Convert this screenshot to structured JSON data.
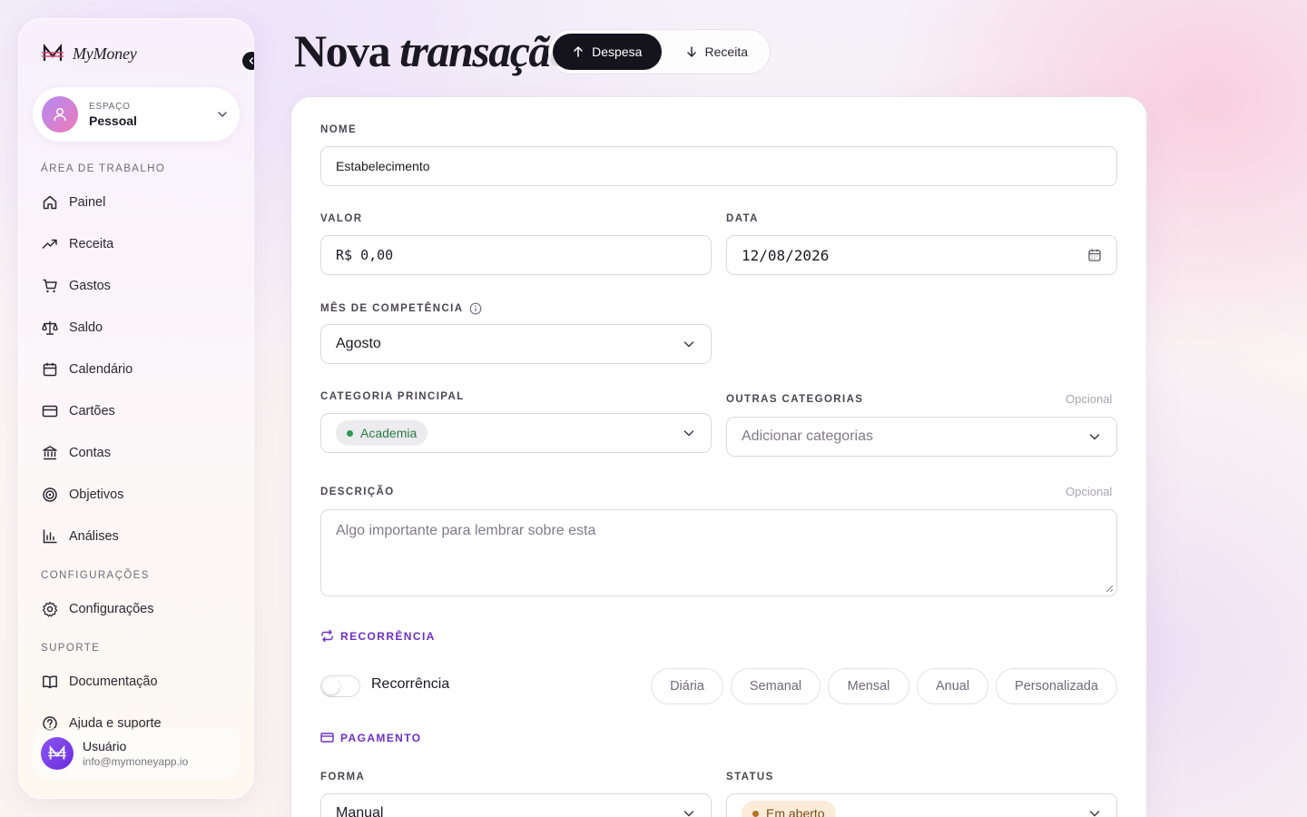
{
  "brand": {
    "name": "MyMoney",
    "logo_icon": "m-strikethrough-logo-icon"
  },
  "space": {
    "label": "ESPAÇO",
    "value": "Pessoal"
  },
  "sidebar": {
    "sections": {
      "workspace": "ÁREA DE TRABALHO",
      "settings": "CONFIGURAÇÕES",
      "support": "SUPORTE"
    },
    "items": [
      {
        "label": "Painel",
        "icon": "home-icon"
      },
      {
        "label": "Receita",
        "icon": "trend-up-icon"
      },
      {
        "label": "Gastos",
        "icon": "cart-icon"
      },
      {
        "label": "Saldo",
        "icon": "scale-icon"
      },
      {
        "label": "Calendário",
        "icon": "calendar-icon"
      },
      {
        "label": "Cartões",
        "icon": "credit-card-icon"
      },
      {
        "label": "Contas",
        "icon": "bank-icon"
      },
      {
        "label": "Objetivos",
        "icon": "target-icon"
      },
      {
        "label": "Análises",
        "icon": "bar-chart-icon"
      },
      {
        "label": "Configurações",
        "icon": "gear-icon"
      },
      {
        "label": "Documentação",
        "icon": "book-icon"
      },
      {
        "label": "Ajuda e suporte",
        "icon": "help-circle-icon"
      }
    ]
  },
  "user": {
    "name": "Usuário",
    "email": "info@mymoneyapp.io"
  },
  "header": {
    "title_regular": "Nova",
    "title_italic": "transação",
    "toggle": {
      "expense": "Despesa",
      "income": "Receita",
      "active": "Despesa"
    }
  },
  "form": {
    "name": {
      "label": "NOME",
      "value": "Estabelecimento"
    },
    "value": {
      "label": "VALOR",
      "value": "R$ 0,00"
    },
    "date": {
      "label": "DATA",
      "value": "12/08/2026"
    },
    "competence": {
      "label": "MÊS DE COMPETÊNCIA",
      "value": "Agosto"
    },
    "main_category": {
      "label": "CATEGORIA PRINCIPAL",
      "value": "Academia",
      "chip_color": "#2f9a55"
    },
    "other_categories": {
      "label": "OUTRAS CATEGORIAS",
      "optional": "Opcional",
      "placeholder": "Adicionar categorias"
    },
    "description": {
      "label": "DESCRIÇÃO",
      "optional": "Opcional",
      "placeholder": "Algo importante para lembrar sobre esta"
    },
    "recurrence": {
      "section": "RECORRÊNCIA",
      "toggle_label": "Recorrência",
      "enabled": false,
      "options": [
        "Diária",
        "Semanal",
        "Mensal",
        "Anual",
        "Personalizada"
      ]
    },
    "payment": {
      "section": "PAGAMENTO",
      "method": {
        "label": "FORMA",
        "value": "Manual"
      },
      "status": {
        "label": "STATUS",
        "value": "Em aberto",
        "chip_color": "#b07424"
      }
    }
  },
  "colors": {
    "accent": "#6b2fc7",
    "dark": "#15131c"
  }
}
